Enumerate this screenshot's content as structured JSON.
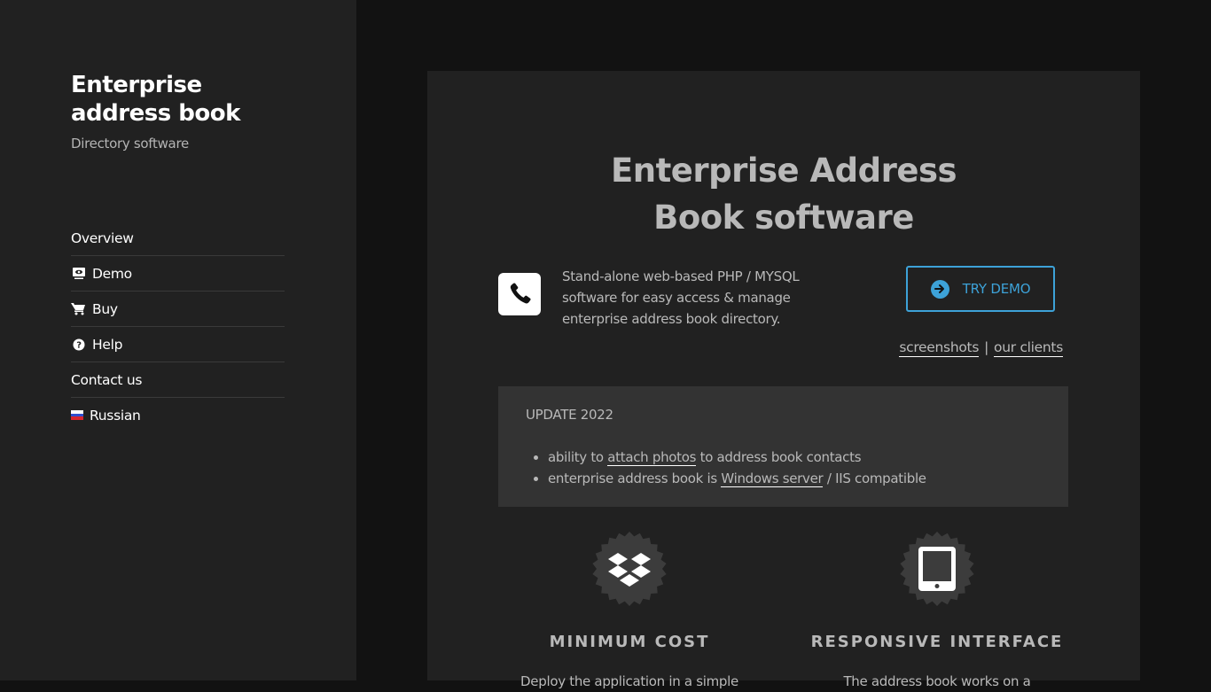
{
  "sidebar": {
    "brand_title": "Enterprise address book",
    "brand_subtitle": "Directory software",
    "nav": [
      {
        "label": "Overview",
        "icon": ""
      },
      {
        "label": "Demo",
        "icon": "monitor-eye-icon"
      },
      {
        "label": "Buy",
        "icon": "cart-icon"
      },
      {
        "label": "Help",
        "icon": "question-circle-icon"
      },
      {
        "label": "Contact us",
        "icon": ""
      },
      {
        "label": "Russian",
        "icon": "russian-flag-icon"
      }
    ]
  },
  "main": {
    "title": "Enterprise Address Book software",
    "intro": "Stand-alone web-based PHP / MYSQL software for easy access & manage enterprise address book directory.",
    "try_demo_label": "TRY DEMO",
    "links": {
      "screenshots": "screenshots",
      "separator": "|",
      "clients": "our clients"
    },
    "update": {
      "title": "UPDATE 2022",
      "items": [
        {
          "pre": "ability to ",
          "link": "attach photos",
          "post": " to address book contacts"
        },
        {
          "pre": "enterprise address book is ",
          "link": "Windows server",
          "post": " / IIS compatible"
        }
      ]
    },
    "features": [
      {
        "icon": "dropbox-icon",
        "title": "MINIMUM COST",
        "text": "Deploy the application in a simple"
      },
      {
        "icon": "tablet-icon",
        "title": "RESPONSIVE INTERFACE",
        "text": "The address book works on a"
      }
    ]
  },
  "colors": {
    "accent": "#3da2d8",
    "sidebar_bg": "#212121",
    "page_bg": "#121212",
    "update_bg": "#333333",
    "text": "#b9b9b9"
  }
}
